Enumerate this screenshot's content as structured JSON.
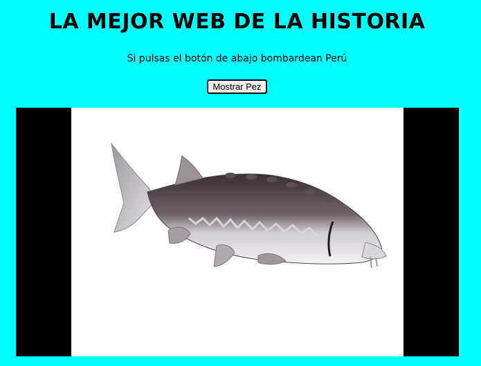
{
  "page": {
    "title": "LA MEJOR WEB DE LA HISTORIA",
    "subtitle": "Si pulsas el botón de abajo bombardean Perú",
    "button_label": "Mostrar Pez"
  },
  "media": {
    "background": "#000000",
    "frame_background": "#fdfcff",
    "subject_icon": "fish-image"
  },
  "colors": {
    "page_background": "#00ffff"
  }
}
